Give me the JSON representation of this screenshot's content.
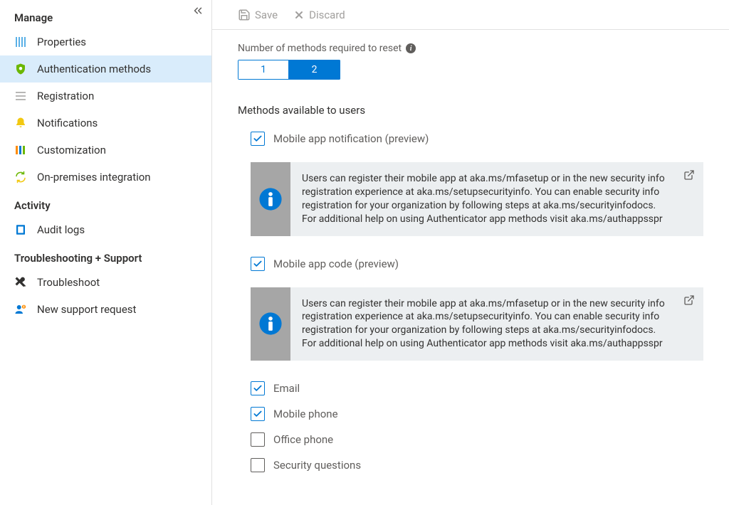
{
  "sidebar": {
    "collapse_label": "Collapse",
    "sections": [
      {
        "title": "Manage",
        "items": [
          {
            "label": "Properties",
            "icon": "properties"
          },
          {
            "label": "Authentication methods",
            "icon": "shield"
          },
          {
            "label": "Registration",
            "icon": "list"
          },
          {
            "label": "Notifications",
            "icon": "bell"
          },
          {
            "label": "Customization",
            "icon": "palette"
          },
          {
            "label": "On-premises integration",
            "icon": "sync"
          }
        ]
      },
      {
        "title": "Activity",
        "items": [
          {
            "label": "Audit logs",
            "icon": "book"
          }
        ]
      },
      {
        "title": "Troubleshooting + Support",
        "items": [
          {
            "label": "Troubleshoot",
            "icon": "tools"
          },
          {
            "label": "New support request",
            "icon": "support"
          }
        ]
      }
    ],
    "active_item": "Authentication methods"
  },
  "toolbar": {
    "save_label": "Save",
    "discard_label": "Discard"
  },
  "settings": {
    "methods_required_label": "Number of methods required to reset",
    "methods_required_options": [
      "1",
      "2"
    ],
    "methods_required_selected": "2",
    "methods_available_label": "Methods available to users",
    "info_text": "Users can register their mobile app at aka.ms/mfasetup or in the new security info registration experience at aka.ms/setupsecurityinfo. You can enable security info registration for your organization by following steps at aka.ms/securityinfodocs. For additional help on using Authenticator app methods visit aka.ms/authappsspr",
    "methods": [
      {
        "label": "Mobile app notification (preview)",
        "checked": true,
        "has_info": true
      },
      {
        "label": "Mobile app code (preview)",
        "checked": true,
        "has_info": true
      },
      {
        "label": "Email",
        "checked": true,
        "has_info": false
      },
      {
        "label": "Mobile phone",
        "checked": true,
        "has_info": false
      },
      {
        "label": "Office phone",
        "checked": false,
        "has_info": false
      },
      {
        "label": "Security questions",
        "checked": false,
        "has_info": false
      }
    ]
  }
}
